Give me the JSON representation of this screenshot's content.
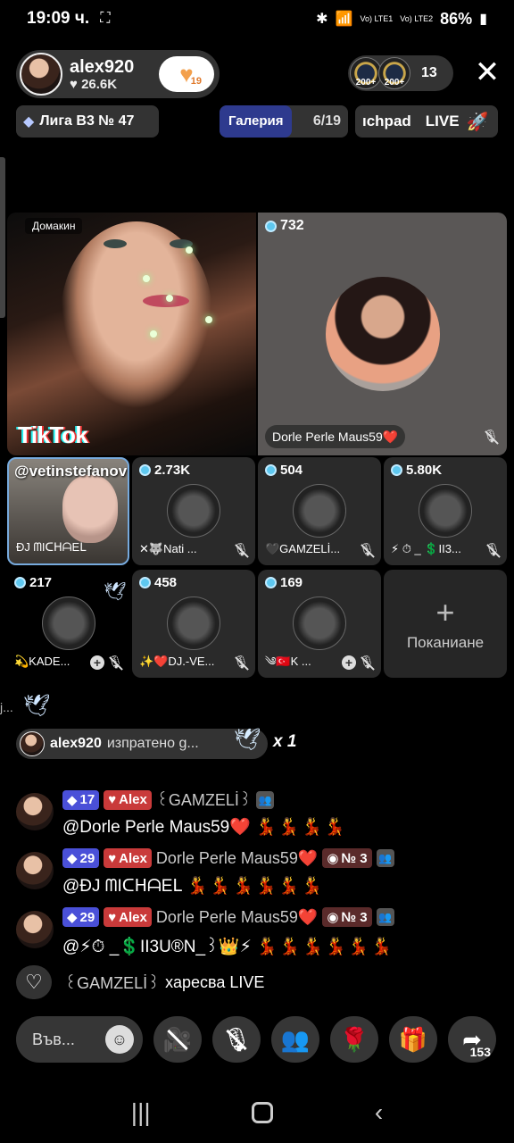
{
  "status_bar": {
    "time": "19:09 ч.",
    "network1": "Vo) LTE1",
    "network2": "Vo) LTE2",
    "battery": "86%"
  },
  "header": {
    "host_name": "alex920",
    "host_likes": "26.6K",
    "follow_count": "19",
    "viewer_coins": [
      "200+",
      "200+"
    ],
    "viewer_count": "13",
    "league": "Лига В3 № 47",
    "gallery_label": "Галерия",
    "gallery_count": "6/19",
    "launchpad_label": "ıchpad",
    "launchpad_live": "LIVE"
  },
  "grid": {
    "host_tag": "Домакин",
    "tiktok_logo": "TikTok",
    "main_guest": {
      "coins": "732",
      "name": "Dorle Perle Maus59❤️"
    },
    "guests": [
      {
        "overlay": "@vetinstefanov",
        "coins": "",
        "name": "ĐJ ᗰIᑕᕼᗩEᒪ"
      },
      {
        "coins": "2.73K",
        "name": "✕🐺Nati ..."
      },
      {
        "coins": "504",
        "name": "🖤GAMZELİ..."
      },
      {
        "coins": "5.80K",
        "name": "⚡ ⏱ _ 💲II3..."
      },
      {
        "coins": "217",
        "name": "💫KADE..."
      },
      {
        "coins": "458",
        "name": "✨❤️DJ.-VE..."
      },
      {
        "coins": "169",
        "name": "༄🇹🇷K ..."
      }
    ],
    "invite_label": "Покани​ане"
  },
  "chat": {
    "truncated": "j...",
    "gift_banner": {
      "name": "alex920",
      "text": "изпратено g...",
      "multiplier": "x 1"
    },
    "comments": [
      {
        "level": "17",
        "fan_badge": "Alex",
        "username": "꒰GAMZELİ꒱",
        "text": "@Dorle Perle Maus59❤️",
        "dancers": "💃💃💃💃"
      },
      {
        "level": "29",
        "fan_badge": "Alex",
        "username": "Dorle Perle Maus59❤️",
        "rank": "№ 3",
        "text": "@ĐJ ᗰIᑕᕼᗩEᒪ",
        "dancers": "💃💃💃💃💃💃"
      },
      {
        "level": "29",
        "fan_badge": "Alex",
        "username": "Dorle Perle Maus59❤️",
        "rank": "№ 3",
        "text": "@⚡⏱ _💲II3U®N_꒱👑⚡",
        "dancers": "💃💃💃💃💃💃"
      }
    ],
    "liked": {
      "name": "꒰GAMZELİ꒱",
      "text": "харесва LIVE"
    }
  },
  "bottom_bar": {
    "input_placeholder": "Във...",
    "share_count": "153"
  }
}
